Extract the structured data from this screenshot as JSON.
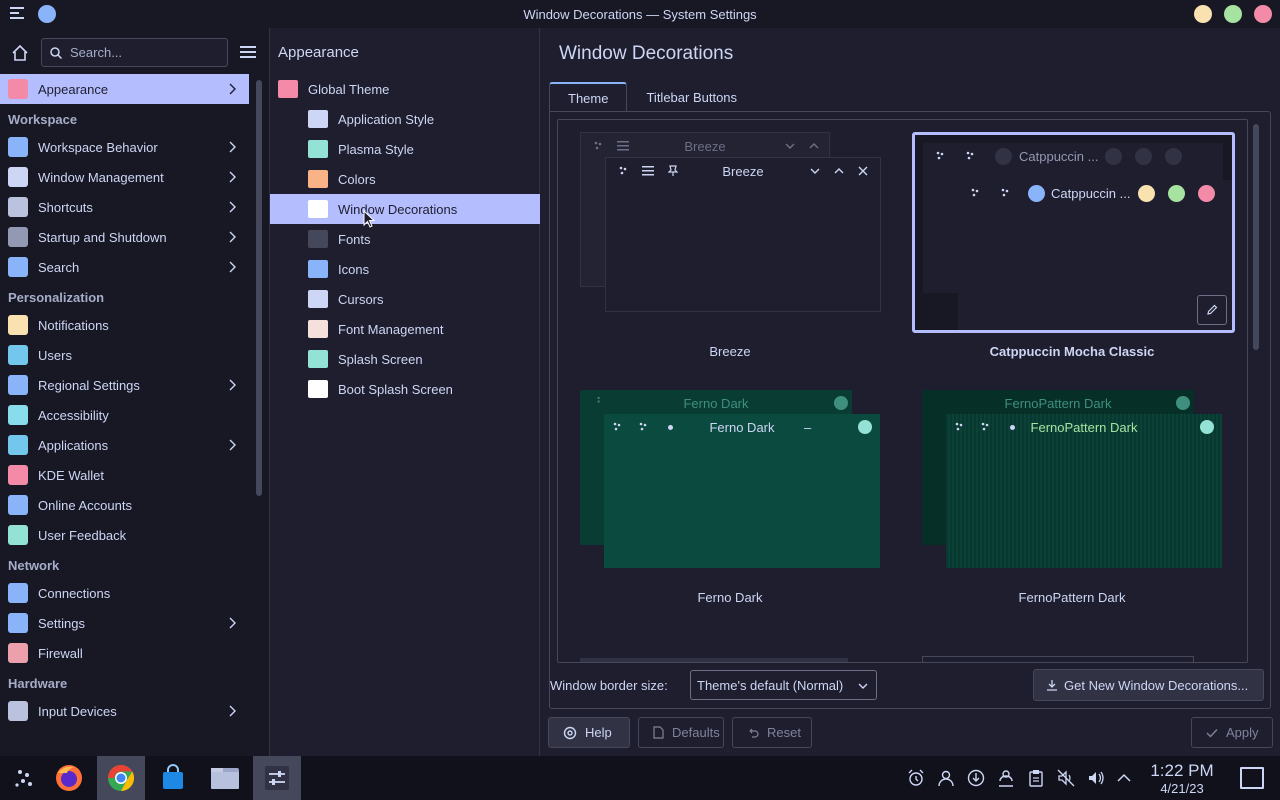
{
  "window": {
    "title": "Window Decorations — System Settings",
    "buttons": [
      {
        "name": "minimize",
        "color": "#f9e2af"
      },
      {
        "name": "maximize",
        "color": "#a6e3a1"
      },
      {
        "name": "close",
        "color": "#f38ba8"
      }
    ]
  },
  "colors": {
    "accent": "#b4befe",
    "bg": "#1e1e2e",
    "surface": "#181825",
    "text": "#cdd6f4",
    "ferno": "#0b4a3f"
  },
  "sidebar": {
    "search_placeholder": "Search...",
    "active": {
      "label": "Appearance",
      "icon": "appearance-icon",
      "color": "#f38ba8"
    },
    "sections": [
      {
        "header": "Workspace",
        "items": [
          {
            "label": "Workspace Behavior",
            "icon": "workspace-behavior-icon",
            "color": "#89b4fa",
            "chevron": true
          },
          {
            "label": "Window Management",
            "icon": "window-management-icon",
            "color": "#cdd6f4",
            "chevron": true
          },
          {
            "label": "Shortcuts",
            "icon": "keyboard-icon",
            "color": "#bac2de",
            "chevron": true
          },
          {
            "label": "Startup and Shutdown",
            "icon": "startup-icon",
            "color": "#9399b2",
            "chevron": true
          },
          {
            "label": "Search",
            "icon": "search-icon",
            "color": "#89b4fa",
            "chevron": true
          }
        ]
      },
      {
        "header": "Personalization",
        "items": [
          {
            "label": "Notifications",
            "icon": "bell-icon",
            "color": "#f9e2af",
            "chevron": false
          },
          {
            "label": "Users",
            "icon": "users-icon",
            "color": "#74c7ec",
            "chevron": false
          },
          {
            "label": "Regional Settings",
            "icon": "regional-icon",
            "color": "#89b4fa",
            "chevron": true
          },
          {
            "label": "Accessibility",
            "icon": "accessibility-icon",
            "color": "#89dceb",
            "chevron": false
          },
          {
            "label": "Applications",
            "icon": "applications-icon",
            "color": "#74c7ec",
            "chevron": true
          },
          {
            "label": "KDE Wallet",
            "icon": "wallet-icon",
            "color": "#f38ba8",
            "chevron": false
          },
          {
            "label": "Online Accounts",
            "icon": "online-accounts-icon",
            "color": "#89b4fa",
            "chevron": false
          },
          {
            "label": "User Feedback",
            "icon": "feedback-icon",
            "color": "#94e2d5",
            "chevron": false
          }
        ]
      },
      {
        "header": "Network",
        "items": [
          {
            "label": "Connections",
            "icon": "globe-icon",
            "color": "#89b4fa",
            "chevron": false
          },
          {
            "label": "Settings",
            "icon": "network-settings-icon",
            "color": "#89b4fa",
            "chevron": true
          },
          {
            "label": "Firewall",
            "icon": "firewall-icon",
            "color": "#eba0ac",
            "chevron": false
          }
        ]
      },
      {
        "header": "Hardware",
        "items": [
          {
            "label": "Input Devices",
            "icon": "mouse-icon",
            "color": "#bac2de",
            "chevron": true
          }
        ]
      }
    ]
  },
  "midcol": {
    "title": "Appearance",
    "items": [
      {
        "label": "Global Theme",
        "icon": "global-theme-icon",
        "color": "#f38ba8",
        "root": true
      },
      {
        "label": "Application Style",
        "icon": "application-style-icon",
        "color": "#cdd6f4"
      },
      {
        "label": "Plasma Style",
        "icon": "plasma-style-icon",
        "color": "#94e2d5"
      },
      {
        "label": "Colors",
        "icon": "colors-icon",
        "color": "#fab387"
      },
      {
        "label": "Window Decorations",
        "icon": "window-decorations-icon",
        "color": "#ffffff",
        "active": true
      },
      {
        "label": "Fonts",
        "icon": "fonts-icon",
        "color": "#45475a"
      },
      {
        "label": "Icons",
        "icon": "icons-icon",
        "color": "#89b4fa"
      },
      {
        "label": "Cursors",
        "icon": "cursors-icon",
        "color": "#cdd6f4"
      },
      {
        "label": "Font Management",
        "icon": "font-management-icon",
        "color": "#f5e0dc"
      },
      {
        "label": "Splash Screen",
        "icon": "splash-screen-icon",
        "color": "#94e2d5"
      },
      {
        "label": "Boot Splash Screen",
        "icon": "boot-splash-icon",
        "color": "#ffffff"
      }
    ]
  },
  "content": {
    "title": "Window Decorations",
    "tabs": [
      "Theme",
      "Titlebar Buttons"
    ],
    "decorations": [
      {
        "name": "Breeze",
        "preview_title": "Breeze",
        "selected": false
      },
      {
        "name": "Catppuccin Mocha Classic",
        "preview_title": "Catppuccin ...",
        "selected": true
      },
      {
        "name": "Ferno Dark",
        "preview_title": "Ferno Dark",
        "selected": false
      },
      {
        "name": "FernoPattern Dark",
        "preview_title": "FernoPattern Dark",
        "selected": false
      }
    ],
    "border_size_label": "Window border size:",
    "border_size_value": "Theme's default (Normal)",
    "get_new_label": "Get New Window Decorations...",
    "buttons": {
      "help": "Help",
      "defaults": "Defaults",
      "reset": "Reset",
      "apply": "Apply"
    }
  },
  "taskbar": {
    "apps": [
      "launcher-icon",
      "firefox-icon",
      "chrome-icon",
      "store-icon",
      "files-icon",
      "system-settings-icon"
    ],
    "tray": [
      "alarm-icon",
      "user-icon",
      "update-icon",
      "people-icon",
      "clipboard-icon",
      "mute-icon",
      "volume-icon",
      "expand-icon"
    ],
    "time": "1:22 PM",
    "date": "4/21/23"
  }
}
